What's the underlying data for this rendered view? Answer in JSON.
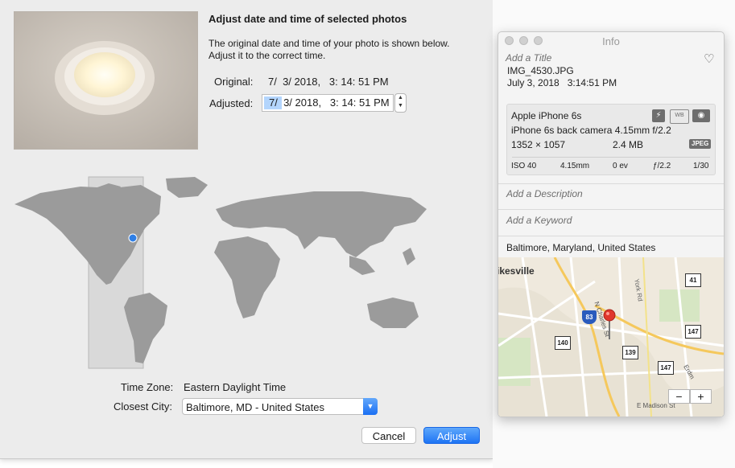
{
  "sheet": {
    "title": "Adjust date and time of selected photos",
    "description": "The original date and time of your photo is shown below. Adjust it to the correct time.",
    "original_label": "Original:",
    "original_value": "7/  3/ 2018,   3: 14: 51 PM",
    "adjusted_label": "Adjusted:",
    "adjusted_month": "7",
    "adjusted_rest": "/  3/ 2018,   3: 14: 51 PM",
    "timezone_label": "Time Zone:",
    "timezone_value": "Eastern Daylight Time",
    "city_label": "Closest City:",
    "city_value": "Baltimore, MD - United States",
    "cancel_label": "Cancel",
    "adjust_label": "Adjust"
  },
  "info": {
    "window_title": "Info",
    "add_title_placeholder": "Add a Title",
    "filename": "IMG_4530.JPG",
    "date": "July 3, 2018",
    "time": "3:14:51 PM",
    "camera_model": "Apple iPhone 6s",
    "lens": "iPhone 6s back camera 4.15mm f/2.2",
    "dimensions": "1352 × 1057",
    "file_size": "2.4 MB",
    "format_badge": "JPEG",
    "exposure": {
      "iso": "ISO 40",
      "focal_length": "4.15mm",
      "ev": "0 ev",
      "aperture": "ƒ/2.2",
      "shutter": "1/30"
    },
    "description_placeholder": "Add a Description",
    "keyword_placeholder": "Add a Keyword",
    "location": "Baltimore, Maryland, United States",
    "map_labels": {
      "place": "ikesville",
      "street_1": "N Charles St",
      "street_2": "York Rd",
      "street_3": "E Madison St",
      "street_4": "Erdm",
      "shield_83": "83",
      "shield_41": "41",
      "shield_147a": "147",
      "shield_147b": "147",
      "shield_140": "140",
      "shield_139": "139"
    },
    "zoom_out": "−",
    "zoom_in": "+"
  },
  "colors": {
    "accent": "#1e74f4",
    "map_land": "#9b9b9b",
    "pin_blue": "#2f7fe6",
    "pin_red": "#e0362c"
  }
}
